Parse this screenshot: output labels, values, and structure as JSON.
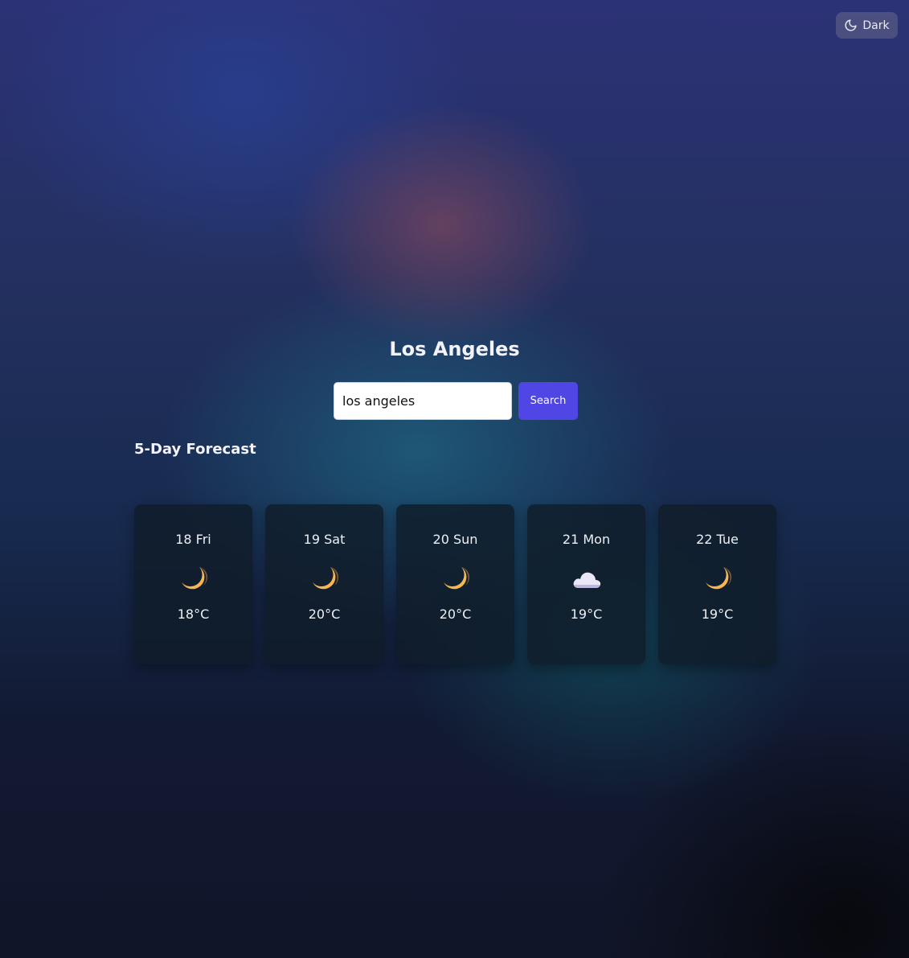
{
  "theme_toggle": {
    "label": "Dark",
    "icon": "moon-outline-icon"
  },
  "city": {
    "name": "Los Angeles"
  },
  "search": {
    "value": "los angeles",
    "button_label": "Search"
  },
  "forecast": {
    "title": "5-Day Forecast",
    "days": [
      {
        "date": "18 Fri",
        "icon": "crescent-moon-icon",
        "temp": "18°C"
      },
      {
        "date": "19 Sat",
        "icon": "crescent-moon-icon",
        "temp": "20°C"
      },
      {
        "date": "20 Sun",
        "icon": "crescent-moon-icon",
        "temp": "20°C"
      },
      {
        "date": "21 Mon",
        "icon": "cloud-icon",
        "temp": "19°C"
      },
      {
        "date": "22 Tue",
        "icon": "crescent-moon-icon",
        "temp": "19°C"
      }
    ]
  },
  "colors": {
    "accent": "#4f46e5",
    "card_bg": "#101c28",
    "moon": "#f6b651",
    "cloud": "#e8e6f7"
  }
}
